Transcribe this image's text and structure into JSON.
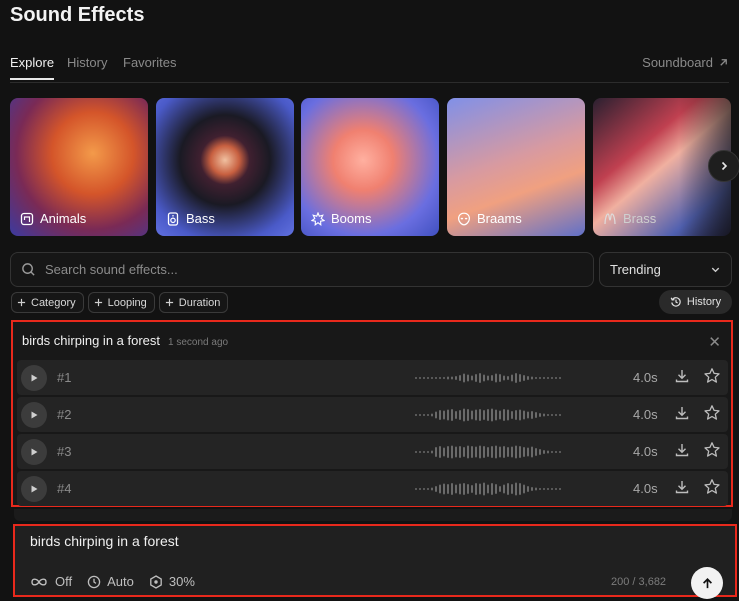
{
  "page": {
    "title": "Sound Effects"
  },
  "tabs": [
    {
      "label": "Explore",
      "active": true
    },
    {
      "label": "History",
      "active": false
    },
    {
      "label": "Favorites",
      "active": false
    }
  ],
  "soundboard_label": "Soundboard",
  "categories": [
    {
      "label": "Animals",
      "icon": "animals-icon"
    },
    {
      "label": "Bass",
      "icon": "speaker-icon"
    },
    {
      "label": "Booms",
      "icon": "explosion-icon"
    },
    {
      "label": "Braams",
      "icon": "alien-icon"
    },
    {
      "label": "Brass",
      "icon": "brass-icon"
    }
  ],
  "search": {
    "placeholder": "Search sound effects...",
    "value": ""
  },
  "sort": {
    "selected": "Trending"
  },
  "filters": [
    "Category",
    "Looping",
    "Duration"
  ],
  "history_button": "History",
  "results": {
    "query": "birds chirping in a forest",
    "time": "1 second ago",
    "items": [
      {
        "num": "#1",
        "duration": "4.0s"
      },
      {
        "num": "#2",
        "duration": "4.0s"
      },
      {
        "num": "#3",
        "duration": "4.0s"
      },
      {
        "num": "#4",
        "duration": "4.0s"
      }
    ]
  },
  "prompt": {
    "text": "birds chirping in a forest",
    "loop": "Off",
    "duration": "Auto",
    "influence": "30%",
    "counter": "200 / 3,682"
  },
  "colors": {
    "highlight": "#e8291c",
    "background": "#121212"
  }
}
